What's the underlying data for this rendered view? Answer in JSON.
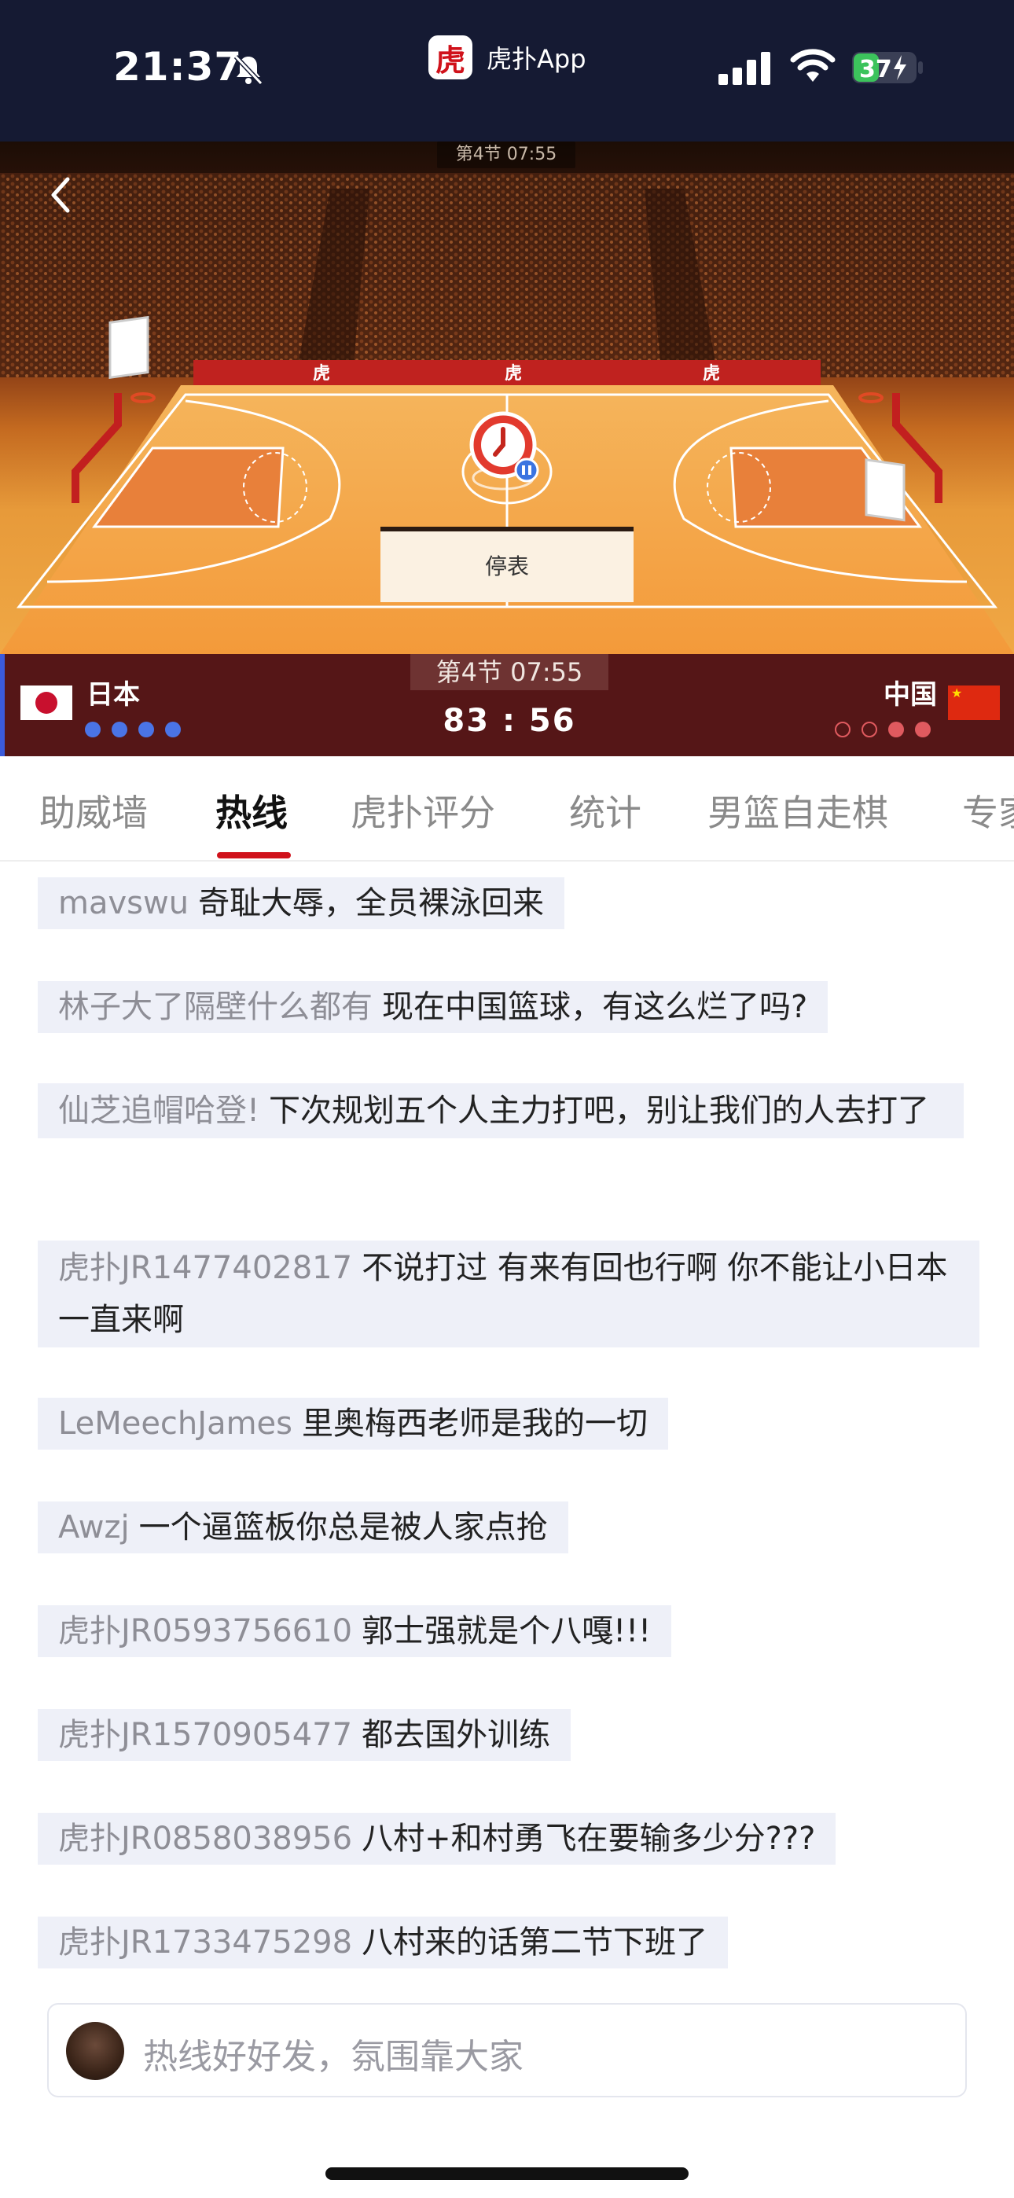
{
  "status_bar": {
    "time": "21:37",
    "app_name": "虎扑App",
    "app_logo_char": "虎",
    "battery": "37",
    "icons": [
      "bell-muted-icon",
      "signal-icon",
      "wifi-icon",
      "battery-charging-icon"
    ]
  },
  "court": {
    "top_period_label": "第4节 07:55",
    "pause_label": "停表",
    "icons": [
      "back-icon",
      "timeout-clock-icon"
    ]
  },
  "scoreboard": {
    "period": "第4节  07:55",
    "home_team": "日本",
    "away_team": "中国",
    "score": "83  :  56",
    "home_timeouts_filled": 4,
    "away_timeouts_filled": 2,
    "away_timeouts_total": 4
  },
  "tabs": [
    {
      "label": "助威墙",
      "active": false
    },
    {
      "label": "热线",
      "active": true
    },
    {
      "label": "虎扑评分",
      "active": false
    },
    {
      "label": "统计",
      "active": false
    },
    {
      "label": "男篮自走棋",
      "active": false
    },
    {
      "label": "专家",
      "active": false
    }
  ],
  "comments": [
    {
      "user": "mavswu",
      "text": "奇耻大辱，全员裸泳回来"
    },
    {
      "user": "林子大了隔壁什么都有",
      "text": "现在中国篮球，有这么烂了吗?"
    },
    {
      "user": "仙芝追帽哈登!",
      "text": "下次规划五个人主力打吧，别让我们的人去打了"
    },
    {
      "user": "虎扑JR1477402817",
      "text": "不说打过 有来有回也行啊 你不能让小日本一直来啊"
    },
    {
      "user": "LeMeechJames",
      "text": "里奥梅西老师是我的一切"
    },
    {
      "user": "Awzj",
      "text": "一个逼篮板你总是被人家点抢"
    },
    {
      "user": "虎扑JR0593756610",
      "text": "郭士强就是个八嘎!!!"
    },
    {
      "user": "虎扑JR1570905477",
      "text": "都去国外训练"
    },
    {
      "user": "虎扑JR0858038956",
      "text": "八村+和村勇飞在要输多少分???"
    },
    {
      "user": "虎扑JR1733475298",
      "text": "八村来的话第二节下班了"
    }
  ],
  "input": {
    "placeholder": "热线好好发，氛围靠大家"
  },
  "colors": {
    "accent": "#d0121b",
    "score_bar": "#551617",
    "status_bg": "#151a33",
    "comment_bg": "#eef0f8"
  }
}
